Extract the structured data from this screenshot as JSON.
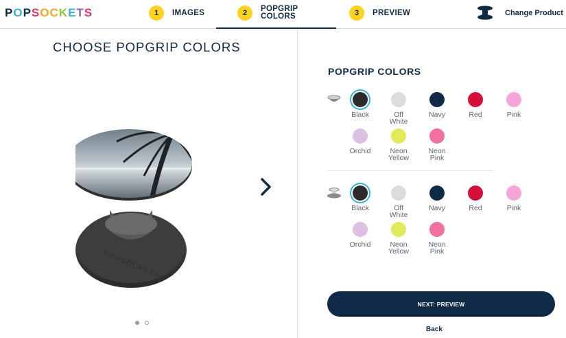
{
  "brand": {
    "letters": [
      "P",
      "O",
      "P",
      "S",
      "O",
      "C",
      "K",
      "E",
      "T",
      "S"
    ],
    "letter_colors": [
      "#0e2a47",
      "#3bb0d8",
      "#0e2a47",
      "#e8346b",
      "#f5a623",
      "#f5a623",
      "#8cc63f",
      "#3bb0d8",
      "#9b59b6",
      "#e8346b"
    ]
  },
  "steps": [
    {
      "num": "1",
      "label": "IMAGES"
    },
    {
      "num": "2",
      "label_line1": "POPGRIP",
      "label_line2": "COLORS"
    },
    {
      "num": "3",
      "label": "PREVIEW"
    }
  ],
  "change_product": {
    "label": "Change Product",
    "icon": "popsocket-product-icon"
  },
  "left": {
    "title": "CHOOSE POPGRIP COLORS",
    "carousel_dots": 2,
    "active_dot": 0
  },
  "right": {
    "title": "POPGRIP COLORS",
    "sections": [
      {
        "icon": "popgrip-top-icon",
        "colors": [
          {
            "line1": "Black",
            "line2": "",
            "hex": "#2b2b2b",
            "selected": true
          },
          {
            "line1": "Off",
            "line2": "White",
            "hex": "#dcdcdc",
            "selected": false
          },
          {
            "line1": "Navy",
            "line2": "",
            "hex": "#0e2a47",
            "selected": false
          },
          {
            "line1": "Red",
            "line2": "",
            "hex": "#d40f3a",
            "selected": false
          },
          {
            "line1": "Pink",
            "line2": "",
            "hex": "#f5a6d8",
            "selected": false
          },
          {
            "line1": "Orchid",
            "line2": "",
            "hex": "#dcc1e3",
            "selected": false
          },
          {
            "line1": "Neon",
            "line2": "Yellow",
            "hex": "#e3ea5a",
            "selected": false
          },
          {
            "line1": "Neon",
            "line2": "Pink",
            "hex": "#f0709e",
            "selected": false
          }
        ]
      },
      {
        "icon": "popgrip-base-icon",
        "colors": [
          {
            "line1": "Black",
            "line2": "",
            "hex": "#2b2b2b",
            "selected": true
          },
          {
            "line1": "Off",
            "line2": "White",
            "hex": "#dcdcdc",
            "selected": false
          },
          {
            "line1": "Navy",
            "line2": "",
            "hex": "#0e2a47",
            "selected": false
          },
          {
            "line1": "Red",
            "line2": "",
            "hex": "#d40f3a",
            "selected": false
          },
          {
            "line1": "Pink",
            "line2": "",
            "hex": "#f5a6d8",
            "selected": false
          },
          {
            "line1": "Orchid",
            "line2": "",
            "hex": "#dcc1e3",
            "selected": false
          },
          {
            "line1": "Neon",
            "line2": "Yellow",
            "hex": "#e3ea5a",
            "selected": false
          },
          {
            "line1": "Neon",
            "line2": "Pink",
            "hex": "#f0709e",
            "selected": false
          }
        ]
      }
    ],
    "next_button": "NEXT: PREVIEW",
    "back_link": "Back"
  },
  "colors": {
    "navy": "#0e2a47",
    "accent_yellow": "#ffd21f",
    "selection_ring": "#3bb0d8"
  }
}
